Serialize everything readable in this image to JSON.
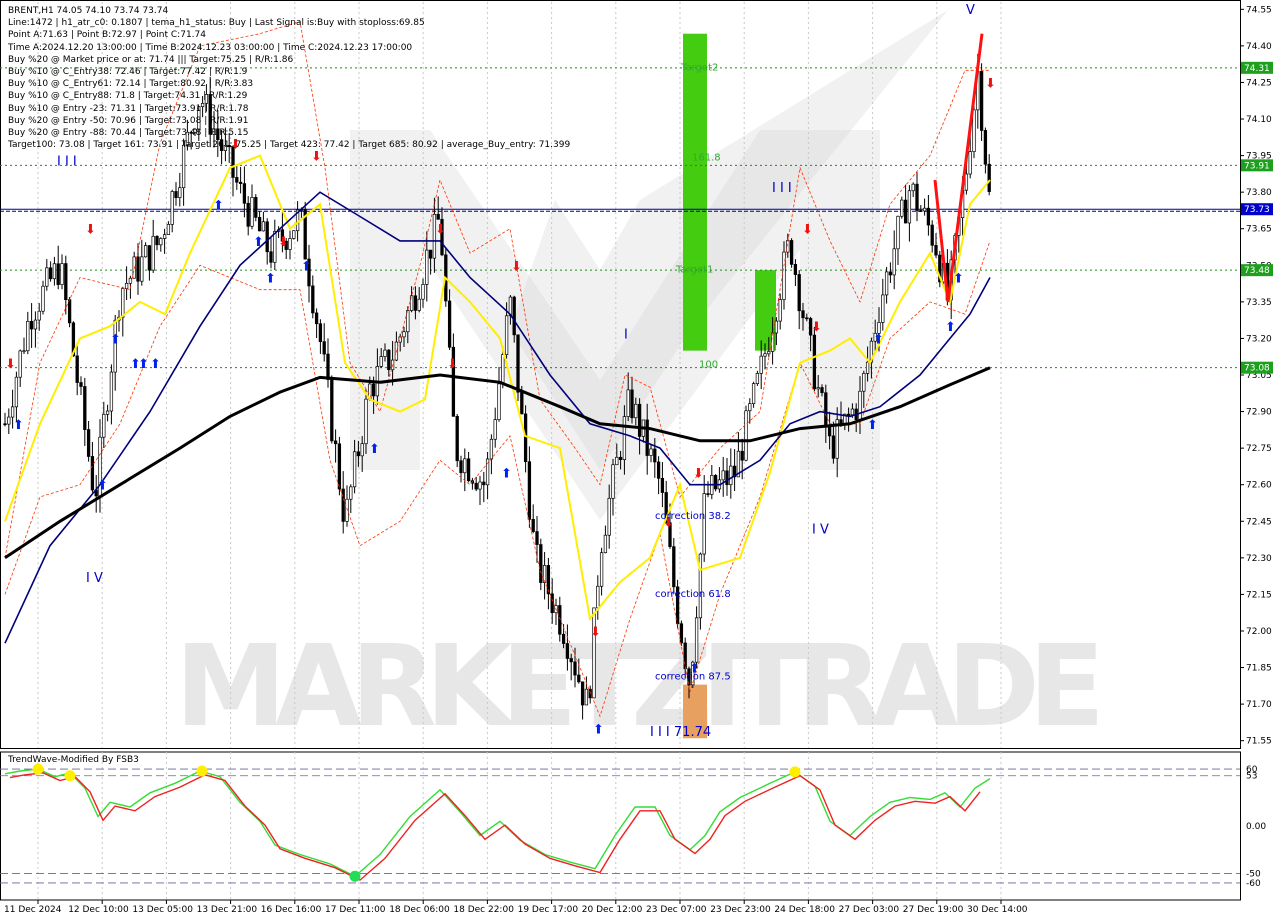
{
  "header": {
    "lines": [
      "BRENT,H1  74.05 74.10 73.74 73.74",
      "Line:1472  |  h1_atr_c0: 0.1807  |  tema_h1_status: Buy  |  Last Signal is:Buy with stoploss:69.85",
      "Point A:71.63  |  Point B:72.97  |  Point C:71.74",
      "Time A:2024.12.20 13:00:00  |  Time B:2024.12.23 03:00:00  |  Time C:2024.12.23 17:00:00",
      "Buy %20 @ Market price or at: 71.74  |||  Target:75.25  |  R/R:1.86",
      "Buy %10 @ C_Entry38: 72.46  |  Target:77.42  |  R/R:1.9",
      "Buy %10 @ C_Entry61: 72.14  |  Target:80.92  |  R/R:3.83",
      "Buy %10 @ C_Entry88: 71.8  |  Target:74.31  |  R/R:1.29",
      "Buy %10 @ Entry -23: 71.31  |  Target:73.91  |  R/R:1.78",
      "Buy %20 @ Entry -50: 70.96  |  Target:73.08  |  R/R:1.91",
      "Buy %20 @ Entry -88: 70.44  |  Target:73.48  |  R/R:5.15",
      "Target100: 73.08  |  Target 161: 73.91  |  Target 261: 75.25  |  Target 423: 77.42  |  Target 685: 80.92  |  average_Buy_entry: 71.399"
    ]
  },
  "oscillator_title": "TrendWave-Modified By FSB3",
  "watermark": "MARKETZITRADE",
  "colors": {
    "green_band": "#44cc11",
    "orange_band": "#e8a060",
    "price_line": "#00008b",
    "label_bg": "#1ea01e",
    "price_label_bg": "#0000cd",
    "ma_yellow": "#ffee00",
    "ma_blue": "#00007a",
    "ma_black": "#000000",
    "envelope": "#ff3300",
    "osc_green": "#33dd33",
    "osc_red": "#ee2222"
  },
  "chart_data": {
    "type": "candlestick",
    "symbol": "BRENT,H1",
    "ohlc_last": {
      "open": 74.05,
      "high": 74.1,
      "low": 73.74,
      "close": 73.74
    },
    "ylim": [
      71.52,
      74.58
    ],
    "y_ticks": [
      "74.55",
      "74.40",
      "74.25",
      "74.10",
      "73.95",
      "73.80",
      "73.65",
      "73.50",
      "73.35",
      "73.20",
      "73.05",
      "72.90",
      "72.75",
      "72.60",
      "72.45",
      "72.30",
      "72.15",
      "72.00",
      "71.85",
      "71.70",
      "71.55"
    ],
    "x_ticks": [
      "11 Dec 2024",
      "12 Dec 10:00",
      "13 Dec 05:00",
      "13 Dec 21:00",
      "16 Dec 16:00",
      "17 Dec 11:00",
      "18 Dec 06:00",
      "18 Dec 22:00",
      "19 Dec 17:00",
      "20 Dec 12:00",
      "23 Dec 07:00",
      "23 Dec 23:00",
      "24 Dec 18:00",
      "27 Dec 03:00",
      "27 Dec 19:00",
      "30 Dec 14:00"
    ],
    "levels": [
      {
        "label": "74.31",
        "value": 74.31,
        "style": "dotted-green"
      },
      {
        "label": "73.91",
        "value": 73.91,
        "style": "dotted-green"
      },
      {
        "label": "73.73",
        "value": 73.73,
        "style": "price-blue"
      },
      {
        "label": "73.48",
        "value": 73.48,
        "style": "dotted-green"
      },
      {
        "label": "73.08",
        "value": 73.08,
        "style": "dotted-green"
      }
    ],
    "annotations": [
      {
        "text": "Target2",
        "color": "#33aa33"
      },
      {
        "text": "161.8",
        "color": "#33aa33"
      },
      {
        "text": "Target1",
        "color": "#33aa33"
      },
      {
        "text": "100",
        "color": "#33aa33"
      },
      {
        "text": "correction 38.2",
        "color": "#0000cc"
      },
      {
        "text": "correction 61.8",
        "color": "#0000cc"
      },
      {
        "text": "correction 87.5",
        "color": "#0000cc"
      },
      {
        "text": "I I I  71.74",
        "color": "#0000cc"
      },
      {
        "text": "I I I",
        "color": "#0000cc"
      },
      {
        "text": "I I I",
        "color": "#0000cc"
      },
      {
        "text": "I V",
        "color": "#0000cc"
      },
      {
        "text": "I V",
        "color": "#0000cc"
      },
      {
        "text": "I",
        "color": "#0000cc"
      },
      {
        "text": "V",
        "color": "#0000cc"
      }
    ],
    "oscillator": {
      "ylim": [
        -78,
        78
      ],
      "y_ticks": [
        "60",
        "53",
        "0.00",
        "-50",
        "-60"
      ],
      "levels": [
        60,
        53,
        -50,
        -60
      ]
    }
  }
}
